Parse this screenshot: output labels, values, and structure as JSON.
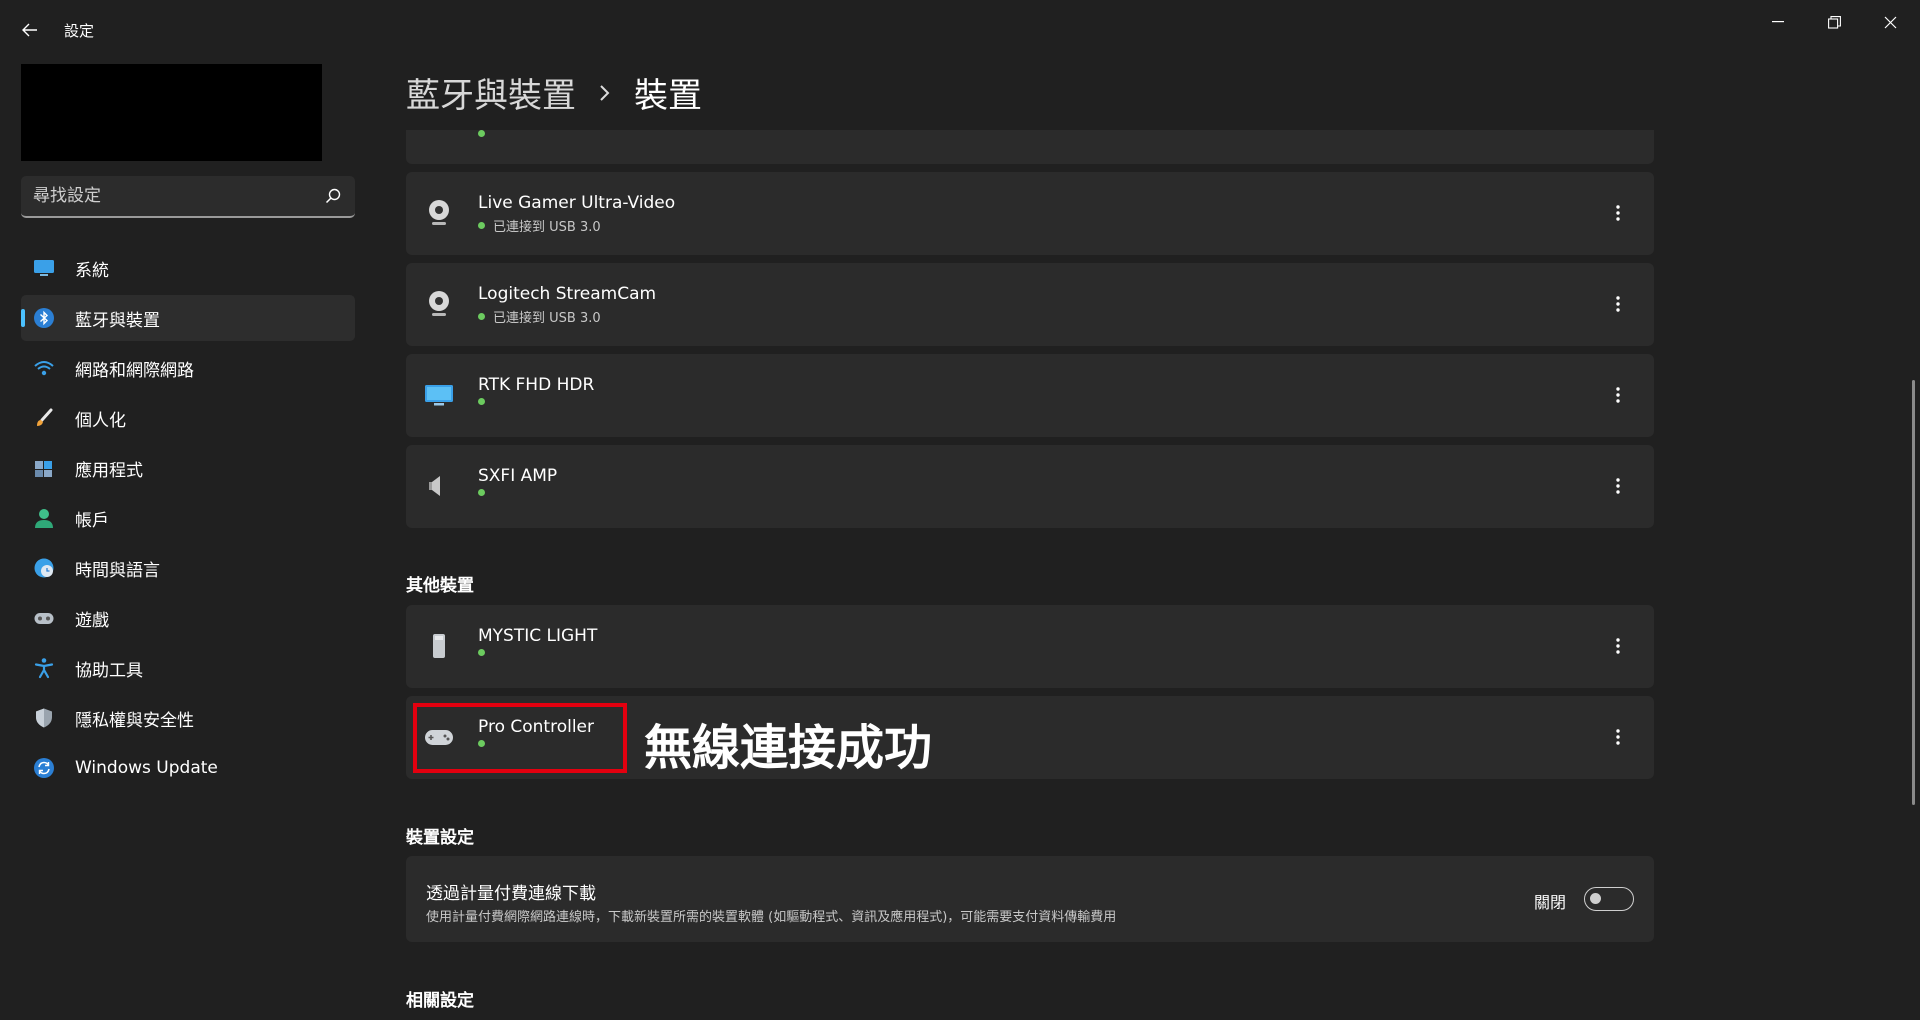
{
  "window": {
    "title": "設定"
  },
  "sidebar": {
    "search_placeholder": "尋找設定",
    "items": [
      {
        "label": "系統",
        "icon": "monitor-icon"
      },
      {
        "label": "藍牙與裝置",
        "icon": "bluetooth-icon",
        "active": true
      },
      {
        "label": "網路和網際網路",
        "icon": "wifi-icon"
      },
      {
        "label": "個人化",
        "icon": "brush-icon"
      },
      {
        "label": "應用程式",
        "icon": "apps-icon"
      },
      {
        "label": "帳戶",
        "icon": "person-icon"
      },
      {
        "label": "時間與語言",
        "icon": "globe-clock-icon"
      },
      {
        "label": "遊戲",
        "icon": "gamepad-icon"
      },
      {
        "label": "協助工具",
        "icon": "accessibility-icon"
      },
      {
        "label": "隱私權與安全性",
        "icon": "shield-icon"
      },
      {
        "label": "Windows Update",
        "icon": "update-icon"
      }
    ]
  },
  "breadcrumb": {
    "parent": "藍牙與裝置",
    "current": "裝置"
  },
  "devices": [
    {
      "name": "Live Gamer Ultra-Video",
      "status": "已連接到 USB 3.0",
      "icon": "webcam-icon"
    },
    {
      "name": "Logitech StreamCam",
      "status": "已連接到 USB 3.0",
      "icon": "webcam-icon"
    },
    {
      "name": "RTK FHD HDR",
      "status": "",
      "icon": "display-icon"
    },
    {
      "name": "SXFI AMP",
      "status": "",
      "icon": "speaker-icon"
    }
  ],
  "other_devices": {
    "heading": "其他裝置",
    "items": [
      {
        "name": "MYSTIC LIGHT",
        "status": "",
        "icon": "device-icon"
      },
      {
        "name": "Pro Controller",
        "status": "",
        "icon": "gamepad-icon"
      }
    ]
  },
  "annotation": {
    "text": "無線連接成功",
    "color": "#e3000f"
  },
  "device_settings": {
    "heading": "裝置設定",
    "metered": {
      "title": "透過計量付費連線下載",
      "description": "使用計量付費網際網路連線時，下載新裝置所需的裝置軟體 (如驅動程式、資訊及應用程式)，可能需要支付資料傳輸費用",
      "toggle_label": "關閉",
      "toggle_on": false
    }
  },
  "related_settings": {
    "heading": "相關設定"
  },
  "colors": {
    "accent": "#4cc2ff",
    "status_dot": "#6ccb5f",
    "background": "#202020",
    "card": "#2b2b2b"
  }
}
